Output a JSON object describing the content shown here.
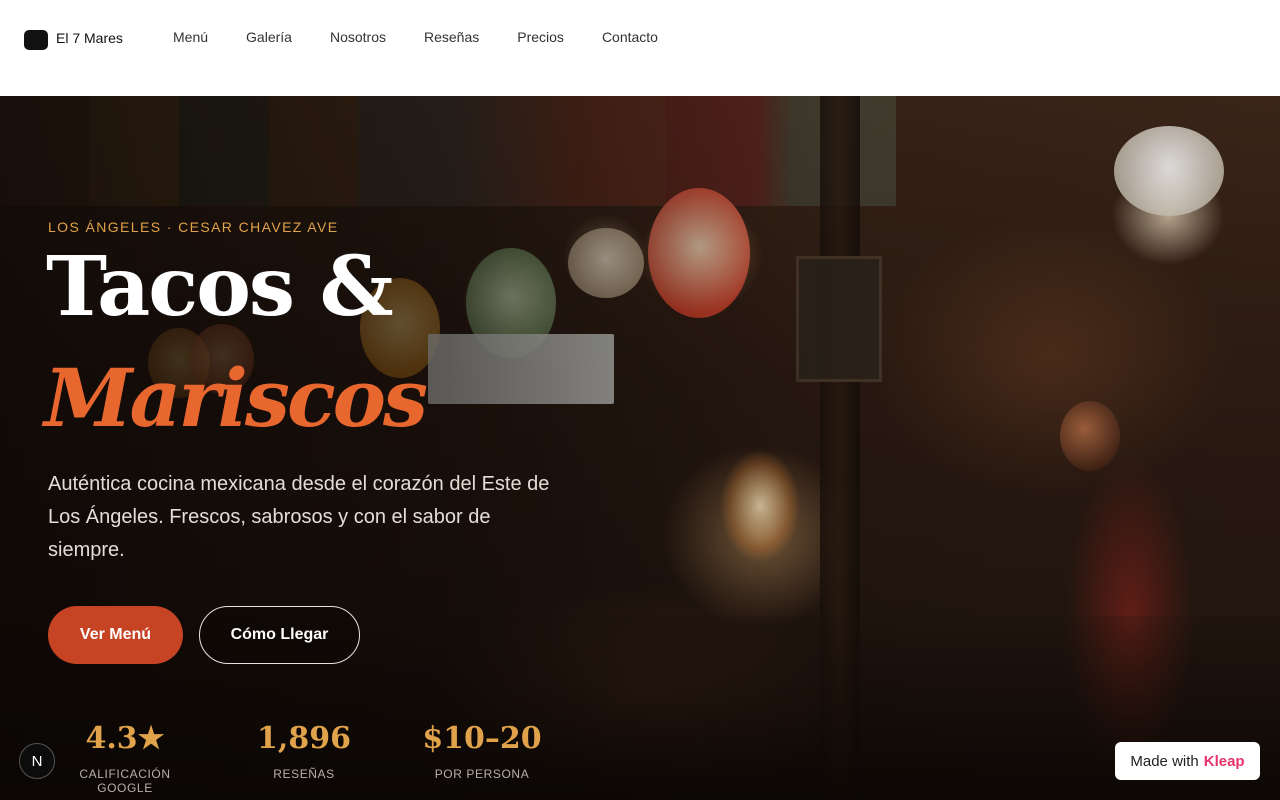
{
  "header": {
    "logo_text": "El 7 Mares",
    "nav": [
      "Menú",
      "Galería",
      "Nosotros",
      "Reseñas",
      "Precios",
      "Contacto"
    ]
  },
  "hero": {
    "eyebrow": "LOS ÁNGELES · CESAR CHAVEZ AVE",
    "title_line1": "Tacos &",
    "title_line2": "Mariscos",
    "subtitle": "Auténtica cocina mexicana desde el corazón del Este de Los Ángeles. Frescos, sabrosos y con el sabor de siempre.",
    "primary_button": "Ver Menú",
    "secondary_button": "Cómo Llegar",
    "stats": [
      {
        "value": "4.3★",
        "label": "CALIFICACIÓN GOOGLE"
      },
      {
        "value": "1,896",
        "label": "RESEÑAS"
      },
      {
        "value": "$10–20",
        "label": "POR PERSONA"
      }
    ]
  },
  "badge": {
    "letter": "N"
  },
  "kleap": {
    "prefix": "Made with",
    "brand": "Kleap"
  },
  "colors": {
    "accent_orange": "#e8672f",
    "accent_gold": "#e0a24a",
    "button_red": "#c64324",
    "kleap_pink": "#e8336a"
  }
}
